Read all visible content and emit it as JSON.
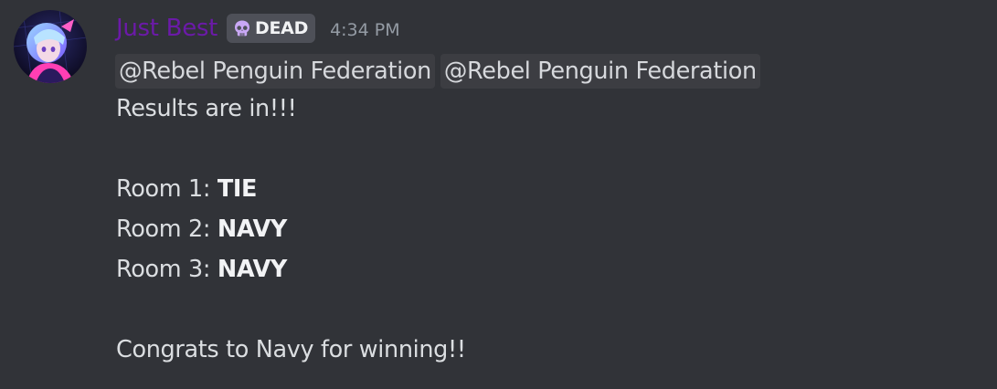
{
  "message": {
    "author": {
      "name": "Just Best",
      "name_color": "#6b1aa8",
      "avatar": "anime-avatar"
    },
    "role_tag": {
      "label": "DEAD",
      "icon": "skull-icon"
    },
    "timestamp": "4:34 PM",
    "mentions": [
      "@Rebel Penguin Federation",
      "@Rebel Penguin Federation"
    ],
    "lines": {
      "intro": "Results are in!!!",
      "room1_label": "Room 1: ",
      "room1_result": "TIE",
      "room2_label": "Room 2: ",
      "room2_result": "NAVY",
      "room3_label": "Room 3: ",
      "room3_result": "NAVY",
      "outro": "Congrats to Navy for winning!!"
    }
  },
  "colors": {
    "background": "#313338",
    "text": "#dbdee1",
    "timestamp": "#949ba4",
    "mention_bg": "#3c3d42",
    "role_tag_bg": "#4e5058"
  }
}
